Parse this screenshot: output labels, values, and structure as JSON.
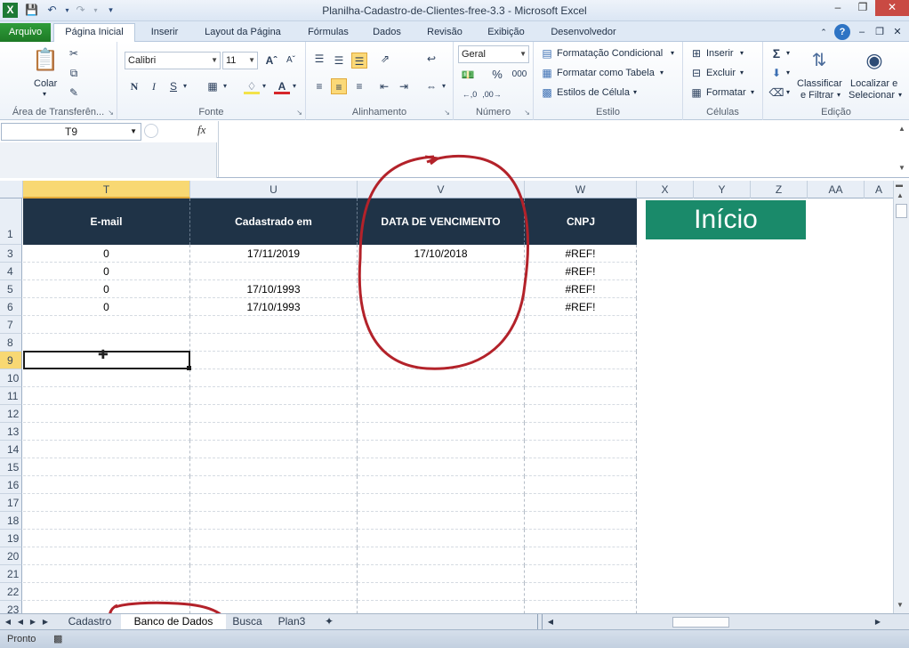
{
  "window": {
    "title": "Planilha-Cadastro-de-Clientes-free-3.3  -  Microsoft Excel",
    "quick_access": [
      "excel-logo-icon",
      "save-icon",
      "undo-icon",
      "redo-icon",
      "customize-icon"
    ]
  },
  "ribbon": {
    "file_tab": "Arquivo",
    "tabs": [
      "Página Inicial",
      "Inserir",
      "Layout da Página",
      "Fórmulas",
      "Dados",
      "Revisão",
      "Exibição",
      "Desenvolvedor"
    ],
    "active_tab": "Página Inicial",
    "clipboard": {
      "paste": "Colar",
      "label": "Área de Transferên..."
    },
    "font": {
      "name": "Calibri",
      "size": "11",
      "bold": "N",
      "italic": "I",
      "underline": "S",
      "label": "Fonte"
    },
    "alignment": {
      "label": "Alinhamento"
    },
    "number": {
      "format": "Geral",
      "percent": "%",
      "thousands": "000",
      "label": "Número"
    },
    "styles": {
      "conditional": "Formatação Condicional",
      "as_table": "Formatar como Tabela",
      "cell_styles": "Estilos de Célula",
      "label": "Estilo"
    },
    "cells": {
      "insert": "Inserir",
      "delete": "Excluir",
      "format": "Formatar",
      "label": "Células"
    },
    "editing": {
      "sort_line1": "Classificar",
      "sort_line2": "e Filtrar",
      "find_line1": "Localizar e",
      "find_line2": "Selecionar",
      "label": "Edição"
    }
  },
  "formula_bar": {
    "name_box": "T9",
    "fx": "fx",
    "content": ""
  },
  "grid": {
    "columns": [
      "T",
      "U",
      "V",
      "W",
      "X",
      "Y",
      "Z",
      "AA",
      "A"
    ],
    "active_column": "T",
    "headers": [
      "E-mail",
      "Cadastrado em",
      "DATA DE VENCIMENTO",
      "CNPJ"
    ],
    "rows": [
      {
        "num": "1"
      },
      {
        "num": "3",
        "cells": [
          "0",
          "17/11/2019",
          "17/10/2018",
          "#REF!"
        ]
      },
      {
        "num": "4",
        "cells": [
          "0",
          "",
          "",
          "#REF!"
        ]
      },
      {
        "num": "5",
        "cells": [
          "0",
          "17/10/1993",
          "",
          "#REF!"
        ]
      },
      {
        "num": "6",
        "cells": [
          "0",
          "17/10/1993",
          "",
          "#REF!"
        ]
      },
      {
        "num": "7"
      },
      {
        "num": "8"
      },
      {
        "num": "9"
      },
      {
        "num": "10"
      },
      {
        "num": "11"
      },
      {
        "num": "12"
      },
      {
        "num": "13"
      },
      {
        "num": "14"
      },
      {
        "num": "15"
      },
      {
        "num": "16"
      },
      {
        "num": "17"
      },
      {
        "num": "18"
      },
      {
        "num": "19"
      },
      {
        "num": "20"
      },
      {
        "num": "21"
      },
      {
        "num": "22"
      },
      {
        "num": "23"
      }
    ],
    "active_row": "9",
    "button_label": "Início"
  },
  "sheets": {
    "tabs": [
      "Cadastro",
      "Banco de Dados",
      "Busca",
      "Plan3"
    ],
    "active": "Banco de Dados"
  },
  "status": {
    "text": "Pronto"
  },
  "colors": {
    "header_bg": "#1f3347",
    "button_bg": "#1a8a6a",
    "annotation": "#b3222a",
    "active_header": "#f8d873"
  }
}
